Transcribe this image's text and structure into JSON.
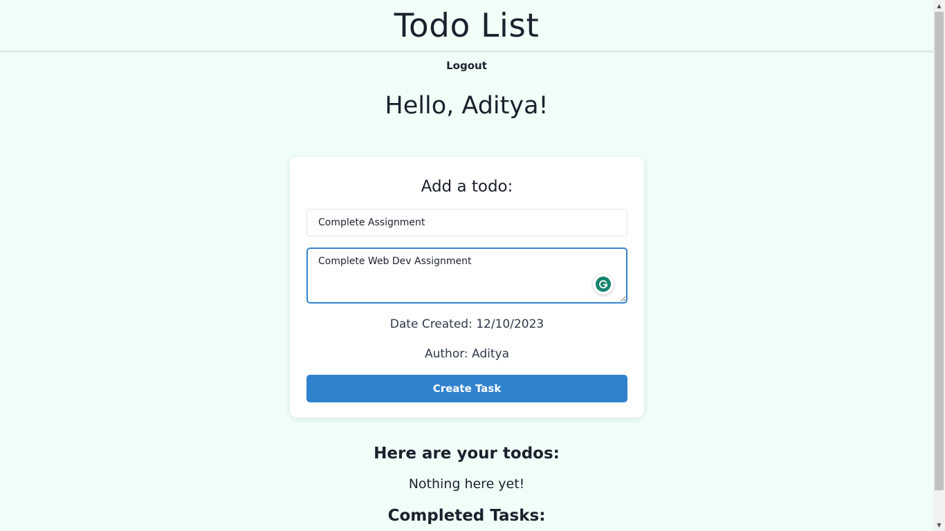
{
  "app": {
    "title": "Todo List"
  },
  "nav": {
    "logout_label": "Logout"
  },
  "greeting": "Hello, Aditya!",
  "form": {
    "heading": "Add a todo:",
    "title_value": "Complete Assignment",
    "description_value": "Complete Web Dev Assignment",
    "date_created": "Date Created: 12/10/2023",
    "author": "Author: Aditya",
    "submit_label": "Create Task"
  },
  "todos": {
    "heading": "Here are your todos:",
    "empty_message": "Nothing here yet!"
  },
  "completed": {
    "heading": "Completed Tasks:"
  },
  "colors": {
    "background": "#f0fff8",
    "accent": "#3182ce",
    "grammarly": "#15826f"
  }
}
